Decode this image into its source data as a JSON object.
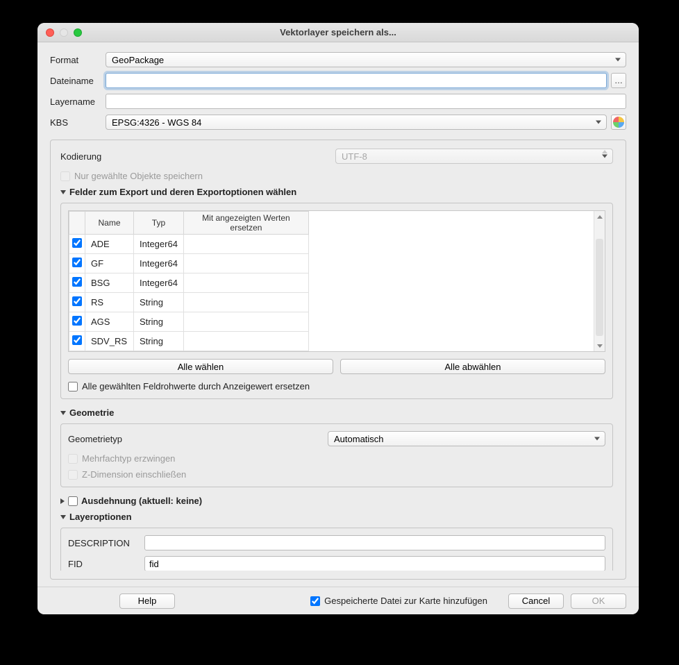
{
  "window": {
    "title": "Vektorlayer speichern als..."
  },
  "labels": {
    "format": "Format",
    "filename": "Dateiname",
    "layername": "Layername",
    "crs": "KBS",
    "encoding": "Kodierung",
    "save_selected": "Nur gewählte Objekte speichern",
    "fields_header": "Felder zum Export und deren Exportoptionen wählen",
    "col_name": "Name",
    "col_type": "Typ",
    "col_replace": "Mit angezeigten Werten ersetzen",
    "select_all": "Alle wählen",
    "deselect_all": "Alle abwählen",
    "replace_raw": "Alle gewählten Feldrohwerte durch Anzeigewert ersetzen",
    "geometry_header": "Geometrie",
    "geometry_type": "Geometrietyp",
    "force_multi": "Mehrfachtyp erzwingen",
    "include_z": "Z-Dimension einschließen",
    "extent_header": "Ausdehnung (aktuell: keine)",
    "layer_options_header": "Layeroptionen",
    "description": "DESCRIPTION",
    "fid": "FID"
  },
  "values": {
    "format": "GeoPackage",
    "filename": "",
    "layername": "",
    "crs": "EPSG:4326 - WGS 84",
    "encoding": "UTF-8",
    "geometry_type": "Automatisch",
    "description": "",
    "fid": "fid"
  },
  "fields": [
    {
      "checked": true,
      "name": "ADE",
      "type": "Integer64"
    },
    {
      "checked": true,
      "name": "GF",
      "type": "Integer64"
    },
    {
      "checked": true,
      "name": "BSG",
      "type": "Integer64"
    },
    {
      "checked": true,
      "name": "RS",
      "type": "String"
    },
    {
      "checked": true,
      "name": "AGS",
      "type": "String"
    },
    {
      "checked": true,
      "name": "SDV_RS",
      "type": "String"
    }
  ],
  "footer": {
    "help": "Help",
    "add_to_map": "Gespeicherte Datei zur Karte hinzufügen",
    "cancel": "Cancel",
    "ok": "OK"
  }
}
